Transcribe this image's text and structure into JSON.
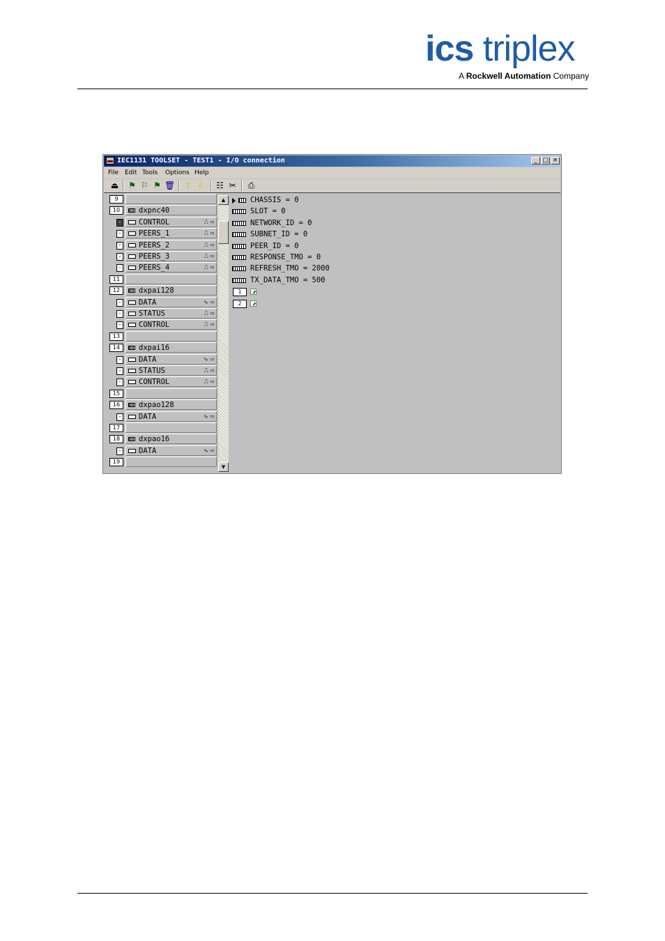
{
  "logo": {
    "brand_a": "ics",
    "brand_b": "triplex",
    "sub_a": "A ",
    "sub_b": "Rockwell Automation",
    "sub_c": " Company"
  },
  "window": {
    "title": "IEC1131 TOOLSET - TEST1 - I/O connection",
    "controls": {
      "minimize": "_",
      "maximize": "□",
      "close": "×"
    },
    "menu": [
      "File",
      "Edit",
      "Tools",
      "Options",
      "Help"
    ]
  },
  "toolbar": {
    "icons": [
      "open-icon",
      "flag-icon",
      "flag-edit-icon",
      "flag-check-icon",
      "trash-icon",
      "arrow-up-icon",
      "arrow-down-icon",
      "properties-icon",
      "scissors-icon",
      "print-icon"
    ]
  },
  "tree": [
    {
      "kind": "slot",
      "num": "9",
      "label": ""
    },
    {
      "kind": "module",
      "num": "10",
      "label": "dxpnc40"
    },
    {
      "kind": "io",
      "label": "CONTROL",
      "sig": "⎍ ⇨",
      "selected": true
    },
    {
      "kind": "io",
      "label": "PEERS_1",
      "sig": "⎍ ⇨"
    },
    {
      "kind": "io",
      "label": "PEERS_2",
      "sig": "⎍ ⇨"
    },
    {
      "kind": "io",
      "label": "PEERS_3",
      "sig": "⎍ ⇨"
    },
    {
      "kind": "io",
      "label": "PEERS_4",
      "sig": "⎍ ⇨"
    },
    {
      "kind": "slot",
      "num": "11",
      "label": ""
    },
    {
      "kind": "module",
      "num": "12",
      "label": "dxpai128"
    },
    {
      "kind": "io",
      "label": "DATA",
      "sig": "∿ ⇨"
    },
    {
      "kind": "io",
      "label": "STATUS",
      "sig": "⎍ ⇨"
    },
    {
      "kind": "io",
      "label": "CONTROL",
      "sig": "⎍ ⇨"
    },
    {
      "kind": "slot",
      "num": "13",
      "label": ""
    },
    {
      "kind": "module",
      "num": "14",
      "label": "dxpai16"
    },
    {
      "kind": "io",
      "label": "DATA",
      "sig": "∿ ⇨"
    },
    {
      "kind": "io",
      "label": "STATUS",
      "sig": "⎍ ⇨"
    },
    {
      "kind": "io",
      "label": "CONTROL",
      "sig": "⎍ ⇨"
    },
    {
      "kind": "slot",
      "num": "15",
      "label": ""
    },
    {
      "kind": "module",
      "num": "16",
      "label": "dxpao128"
    },
    {
      "kind": "io",
      "label": "DATA",
      "sig": "∿ ⇨"
    },
    {
      "kind": "slot",
      "num": "17",
      "label": ""
    },
    {
      "kind": "module",
      "num": "18",
      "label": "dxpao16"
    },
    {
      "kind": "io",
      "label": "DATA",
      "sig": "∿ ⇨"
    },
    {
      "kind": "slot",
      "num": "19",
      "label": ""
    }
  ],
  "params": [
    {
      "kind": "chassis",
      "label": "CHASSIS = 0"
    },
    {
      "kind": "param",
      "label": "SLOT = 0"
    },
    {
      "kind": "param",
      "label": "NETWORK_ID = 0"
    },
    {
      "kind": "param",
      "label": "SUBNET_ID = 0"
    },
    {
      "kind": "param",
      "label": "PEER_ID = 0"
    },
    {
      "kind": "param",
      "label": "RESPONSE_TMO = 0"
    },
    {
      "kind": "param",
      "label": "REFRESH_TMO = 2000"
    },
    {
      "kind": "param",
      "label": "TX_DATA_TMO = 500"
    },
    {
      "kind": "channel",
      "num": "1"
    },
    {
      "kind": "channel",
      "num": "2"
    }
  ]
}
